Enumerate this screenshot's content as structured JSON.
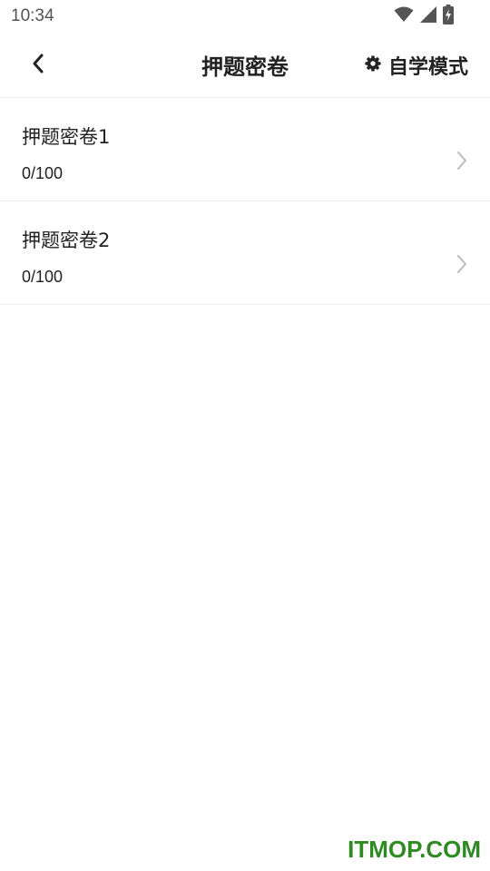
{
  "status_bar": {
    "time": "10:34",
    "icons": [
      "wifi-icon",
      "signal-icon",
      "battery-charging-icon"
    ]
  },
  "nav": {
    "title": "押题密卷",
    "back_icon": "chevron-left-icon",
    "action_icon": "gear-icon",
    "action_label": "自学模式"
  },
  "list": {
    "items": [
      {
        "title": "押题密卷1",
        "progress": "0/100"
      },
      {
        "title": "押题密卷2",
        "progress": "0/100"
      }
    ]
  },
  "watermark": "ITMOP.COM",
  "colors": {
    "text": "#222222",
    "divider": "#eeeeee",
    "chevron": "#bbbbbb",
    "watermark": "#2f8a24"
  }
}
